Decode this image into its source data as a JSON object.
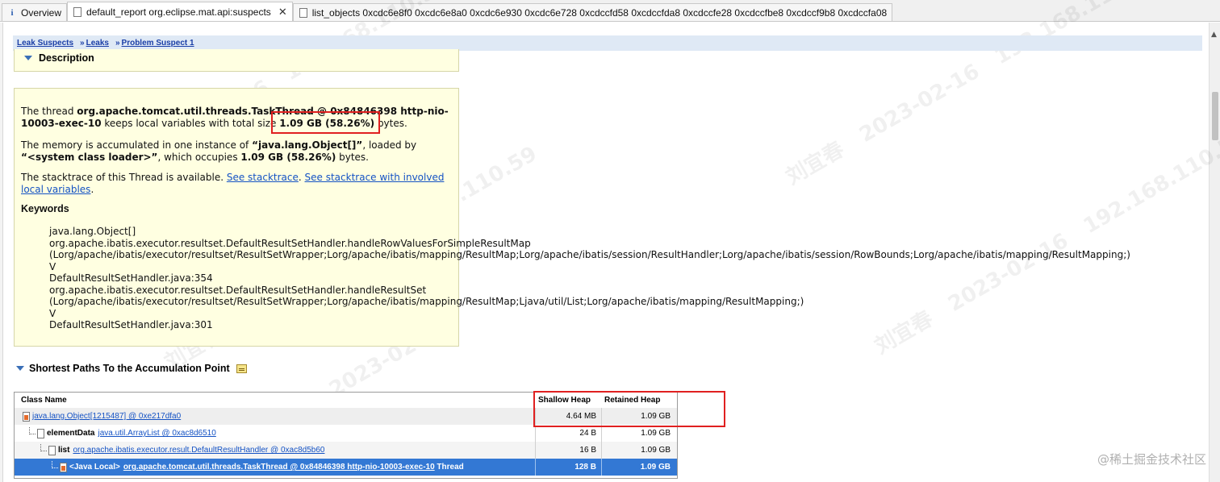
{
  "tabs": [
    {
      "label": "Overview",
      "icon": "info-icon"
    },
    {
      "label": "default_report  org.eclipse.mat.api:suspects",
      "icon": "report-icon",
      "active": true
    },
    {
      "label": "list_objects  0xcdc6e8f0 0xcdc6e8a0 0xcdc6e930 0xcdc6e728 0xcdccfd58 0xcdccfda8 0xcdccfe28 0xcdccfbe8 0xcdccf9b8 0xcdccfa08",
      "icon": "doc-icon"
    }
  ],
  "breadcrumb": {
    "items": [
      "Leak Suspects",
      "Leaks",
      "Problem Suspect 1"
    ],
    "separator": "»"
  },
  "description": {
    "title": "Description",
    "p1_pre": "The thread ",
    "p1_thread": "org.apache.tomcat.util.threads.TaskThread @ 0x84846398 http-nio-10003-exec-10",
    "p1_mid": " keeps local variables with total size ",
    "p1_size": "1.09 GB (58.26%)",
    "p1_post": " bytes.",
    "p2_pre": "The memory is accumulated in one instance of ",
    "p2_class": "“java.lang.Object[]”",
    "p2_mid": ", loaded by ",
    "p2_loader": "“<system class loader>”",
    "p2_mid2": ", which occupies ",
    "p2_size": "1.09 GB (58.26%)",
    "p2_post": " bytes.",
    "p3_pre": "The stacktrace of this Thread is available. ",
    "p3_link1": "See stacktrace",
    "p3_sep": ". ",
    "p3_link2": "See stacktrace with involved local variables",
    "p3_post": ".",
    "keywords_title": "Keywords",
    "keywords": [
      "java.lang.Object[]",
      "org.apache.ibatis.executor.resultset.DefaultResultSetHandler.handleRowValuesForSimpleResultMap",
      "(Lorg/apache/ibatis/executor/resultset/ResultSetWrapper;Lorg/apache/ibatis/mapping/ResultMap;Lorg/apache/ibatis/session/ResultHandler;Lorg/apache/ibatis/session/RowBounds;Lorg/apache/ibatis/mapping/ResultMapping;)",
      "V",
      "DefaultResultSetHandler.java:354",
      "org.apache.ibatis.executor.resultset.DefaultResultSetHandler.handleResultSet",
      "(Lorg/apache/ibatis/executor/resultset/ResultSetWrapper;Lorg/apache/ibatis/mapping/ResultMap;Ljava/util/List;Lorg/apache/ibatis/mapping/ResultMapping;)",
      "V",
      "DefaultResultSetHandler.java:301"
    ]
  },
  "paths": {
    "title": "Shortest Paths To the Accumulation Point",
    "columns": [
      "Class Name",
      "Shallow Heap",
      "Retained Heap"
    ],
    "rows": [
      {
        "field": "",
        "link": "java.lang.Object[1215487] @ 0xe217dfa0",
        "suffix": "",
        "shallow": "4.64 MB",
        "retained": "1.09 GB"
      },
      {
        "field": "elementData",
        "link": "java.util.ArrayList @ 0xac8d6510",
        "suffix": "",
        "shallow": "24 B",
        "retained": "1.09 GB"
      },
      {
        "field": "list",
        "link": "org.apache.ibatis.executor.result.DefaultResultHandler @ 0xac8d5b60",
        "suffix": "",
        "shallow": "16 B",
        "retained": "1.09 GB"
      },
      {
        "field": "<Java Local>",
        "link": "org.apache.tomcat.util.threads.TaskThread @ 0x84846398 http-nio-10003-exec-10",
        "suffix": " Thread",
        "shallow": "128 B",
        "retained": "1.09 GB"
      }
    ]
  },
  "watermark": {
    "name": "刘宜春",
    "date": "2023-02-16",
    "ip": "192.168.110.59"
  },
  "site_mark": "@稀土掘金技术社区",
  "colors": {
    "highlight_box": "#e02020",
    "selected_row": "#3378d4",
    "yellow_panel": "#ffffe1",
    "link": "#1452c4"
  }
}
